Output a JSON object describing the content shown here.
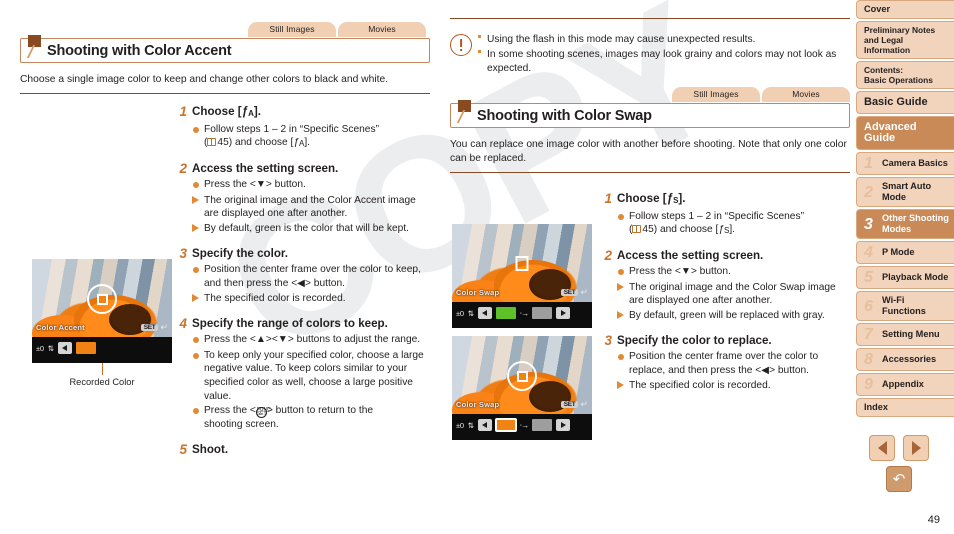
{
  "document": {
    "page_number": "49",
    "watermark": "COPY"
  },
  "left_column": {
    "tabs": [
      {
        "label": "Still Images"
      },
      {
        "label": "Movies"
      }
    ],
    "section_title": "Shooting with Color Accent",
    "lead": "Choose a single image color to keep and change other colors to black and white.",
    "steps": [
      {
        "num": "1",
        "title": "Choose [ A].",
        "bullets": [
          {
            "type": "dot",
            "text": "Follow steps 1 – 2 in “Specific Scenes” ( 45) and choose [ A]."
          }
        ]
      },
      {
        "num": "2",
        "title": "Access the setting screen.",
        "bullets": [
          {
            "type": "dot",
            "text": "Press the <▼> button."
          },
          {
            "type": "tri",
            "text": "The original image and the Color Accent image are displayed one after another."
          },
          {
            "type": "tri",
            "text": "By default, green is the color that will be kept."
          }
        ]
      },
      {
        "num": "3",
        "title": "Specify the color.",
        "bullets": [
          {
            "type": "dot",
            "text": "Position the center frame over the color to keep, and then press the <◀> button."
          },
          {
            "type": "tri",
            "text": "The specified color is recorded."
          }
        ]
      },
      {
        "num": "4",
        "title": "Specify the range of colors to keep.",
        "bullets": [
          {
            "type": "dot",
            "text": "Press the <▲><▼> buttons to adjust the range."
          },
          {
            "type": "dot",
            "text": "To keep only your specified color, choose a large negative value. To keep colors similar to your specified color as well, choose a large positive value."
          },
          {
            "type": "dot",
            "text": "Press the <Ⓕ> button to return to the shooting screen."
          }
        ]
      },
      {
        "num": "5",
        "title": "Shoot.",
        "bullets": []
      }
    ],
    "camera_screen": {
      "mode_label": "Color Accent",
      "set_label": "SET",
      "value": "±0",
      "swatch_color": "#f08313",
      "caption": "Recorded Color"
    }
  },
  "right_column": {
    "warning": {
      "items": [
        "Using the flash in this mode may cause unexpected results.",
        "In some shooting scenes, images may look grainy and colors may not look as expected."
      ]
    },
    "tabs": [
      {
        "label": "Still Images"
      },
      {
        "label": "Movies"
      }
    ],
    "section_title": "Shooting with Color Swap",
    "lead": "You can replace one image color with another before shooting. Note that only one color can be replaced.",
    "camera_screens": [
      {
        "mode_label": "Color Swap",
        "set_label": "SET",
        "value": "±0",
        "from_color": "#5ec12a",
        "to_color": "#9e9e9e"
      },
      {
        "mode_label": "Color Swap",
        "set_label": "SET",
        "value": "±0",
        "from_color": "#f08313",
        "to_color": "#9e9e9e"
      }
    ],
    "steps": [
      {
        "num": "1",
        "title": "Choose [ S].",
        "bullets": [
          {
            "type": "dot",
            "text": "Follow steps 1 – 2 in “Specific Scenes” ( 45) and choose [ S]."
          }
        ]
      },
      {
        "num": "2",
        "title": "Access the setting screen.",
        "bullets": [
          {
            "type": "dot",
            "text": "Press the <▼> button."
          },
          {
            "type": "tri",
            "text": "The original image and the Color Swap image are displayed one after another."
          },
          {
            "type": "tri",
            "text": "By default, green will be replaced with gray."
          }
        ]
      },
      {
        "num": "3",
        "title": "Specify the color to replace.",
        "bullets": [
          {
            "type": "dot",
            "text": "Position the center frame over the color to replace, and then press the <◀> button."
          },
          {
            "type": "tri",
            "text": "The specified color is recorded."
          }
        ]
      }
    ]
  },
  "sidebar": {
    "items": [
      {
        "num": "",
        "label": "Cover",
        "style": "plain",
        "active": false
      },
      {
        "num": "",
        "label": "Preliminary Notes and Legal Information",
        "style": "small",
        "active": false
      },
      {
        "num": "",
        "label": "Contents:\nBasic Operations",
        "style": "small",
        "active": false
      },
      {
        "num": "",
        "label": "Basic Guide",
        "style": "big",
        "active": false
      },
      {
        "num": "",
        "label": "Advanced Guide",
        "style": "advanced",
        "active": true
      },
      {
        "num": "1",
        "label": "Camera Basics",
        "style": "numbered",
        "active": false
      },
      {
        "num": "2",
        "label": "Smart Auto\nMode",
        "style": "numbered",
        "active": false
      },
      {
        "num": "3",
        "label": "Other Shooting\nModes",
        "style": "numbered",
        "active": true
      },
      {
        "num": "4",
        "label": "P Mode",
        "style": "numbered",
        "active": false
      },
      {
        "num": "5",
        "label": "Playback Mode",
        "style": "numbered",
        "active": false
      },
      {
        "num": "6",
        "label": "Wi-Fi Functions",
        "style": "numbered",
        "active": false
      },
      {
        "num": "7",
        "label": "Setting Menu",
        "style": "numbered",
        "active": false
      },
      {
        "num": "8",
        "label": "Accessories",
        "style": "numbered",
        "active": false
      },
      {
        "num": "9",
        "label": "Appendix",
        "style": "numbered",
        "active": false
      },
      {
        "num": "",
        "label": "Index",
        "style": "plain",
        "active": false
      }
    ]
  },
  "page_nav": {
    "prev": "previous-page",
    "next": "next-page",
    "home": "back-to-top"
  },
  "colors": {
    "accent_brown": "#8a4a21",
    "tab_bg": "#f0cfb3",
    "sidebar_active": "#c98a58",
    "step_num": "#c8742b",
    "bullet": "#e08a35"
  }
}
